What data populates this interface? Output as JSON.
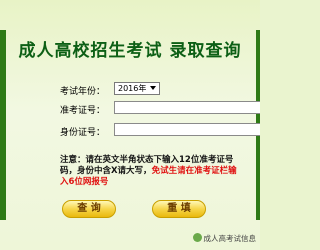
{
  "title": "成人高校招生考试  录取查询",
  "form": {
    "year_label": "考试年份：",
    "year_value": "2016年",
    "ticket_label": "准考证号：",
    "ticket_value": "",
    "id_label": "身份证号：",
    "id_value": "",
    "required_mark": "*"
  },
  "note": {
    "part1": "注意：请在英文半角状态下输入12位准考证号码，身份中含X请大写，",
    "part2": "免试生请在准考证栏输入6位网报号"
  },
  "buttons": {
    "query_label": "查  询",
    "reset_label": "重  填"
  },
  "watermark": "成人高考试信息",
  "colors": {
    "title": "#0c5f15",
    "required": "#e01010",
    "button": "#f6d64a"
  }
}
